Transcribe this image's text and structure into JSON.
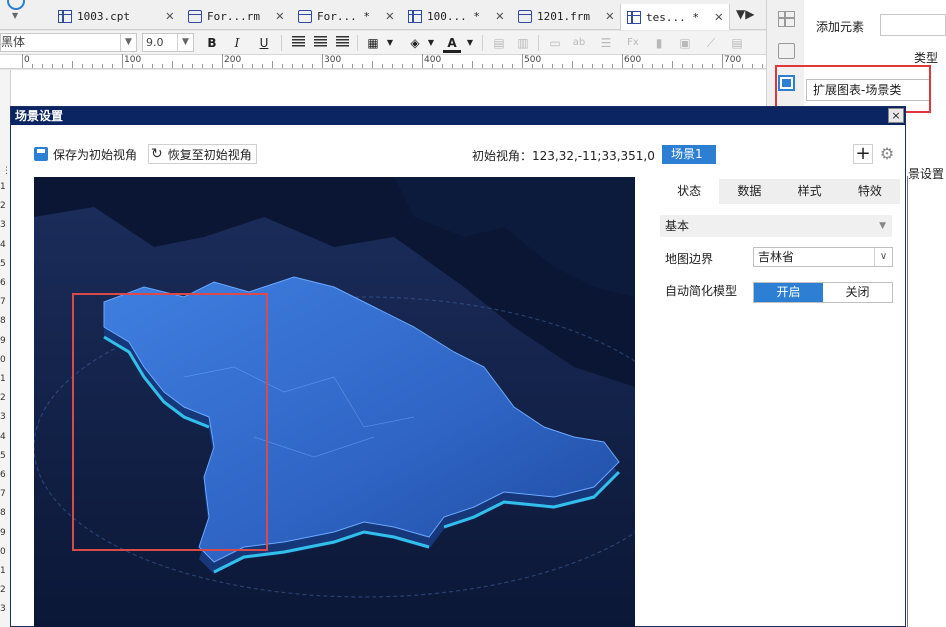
{
  "tabs": [
    {
      "label": "1003.cpt",
      "type": "cpt"
    },
    {
      "label": "For...rm",
      "type": "frm"
    },
    {
      "label": "For... *",
      "type": "frm"
    },
    {
      "label": "100... *",
      "type": "cpt"
    },
    {
      "label": "1201.frm",
      "type": "frm"
    },
    {
      "label": "tes... *",
      "type": "cpt",
      "active": true
    }
  ],
  "format": {
    "font_name": "黑体",
    "font_size": "9.0"
  },
  "ruler": [
    "0",
    "100",
    "200",
    "300",
    "400",
    "500",
    "600",
    "700"
  ],
  "row_numbers": [
    "1",
    "2",
    "3",
    "4",
    "5",
    "6",
    "7",
    "8",
    "9",
    "0",
    "1",
    "2",
    "3",
    "4",
    "5",
    "6",
    "7",
    "8",
    "9",
    "0",
    "1",
    "2",
    "3"
  ],
  "side_panel": {
    "add_element": "添加元素",
    "type_label": "类型",
    "type_value": "扩展图表-场景类",
    "scene_setting": "景设置"
  },
  "dialog": {
    "title": "场景设置",
    "close_glyph": "×",
    "save_view": "保存为初始视角",
    "restore_view": "恢复至初始视角",
    "initial_view": "初始视角：123,32,-11;33,351,0",
    "scene_tab": "场景1",
    "tabs": [
      "状态",
      "数据",
      "样式",
      "特效"
    ],
    "active_tab": "状态",
    "section": "基本",
    "map_border_label": "地图边界",
    "map_border_value": "吉林省",
    "simplify_label": "自动简化模型",
    "toggle_on": "开启",
    "toggle_off": "关闭"
  },
  "colors": {
    "accent": "#2d7fd3",
    "dialog_title_bg": "#0a2561",
    "highlight": "#e0373a"
  }
}
